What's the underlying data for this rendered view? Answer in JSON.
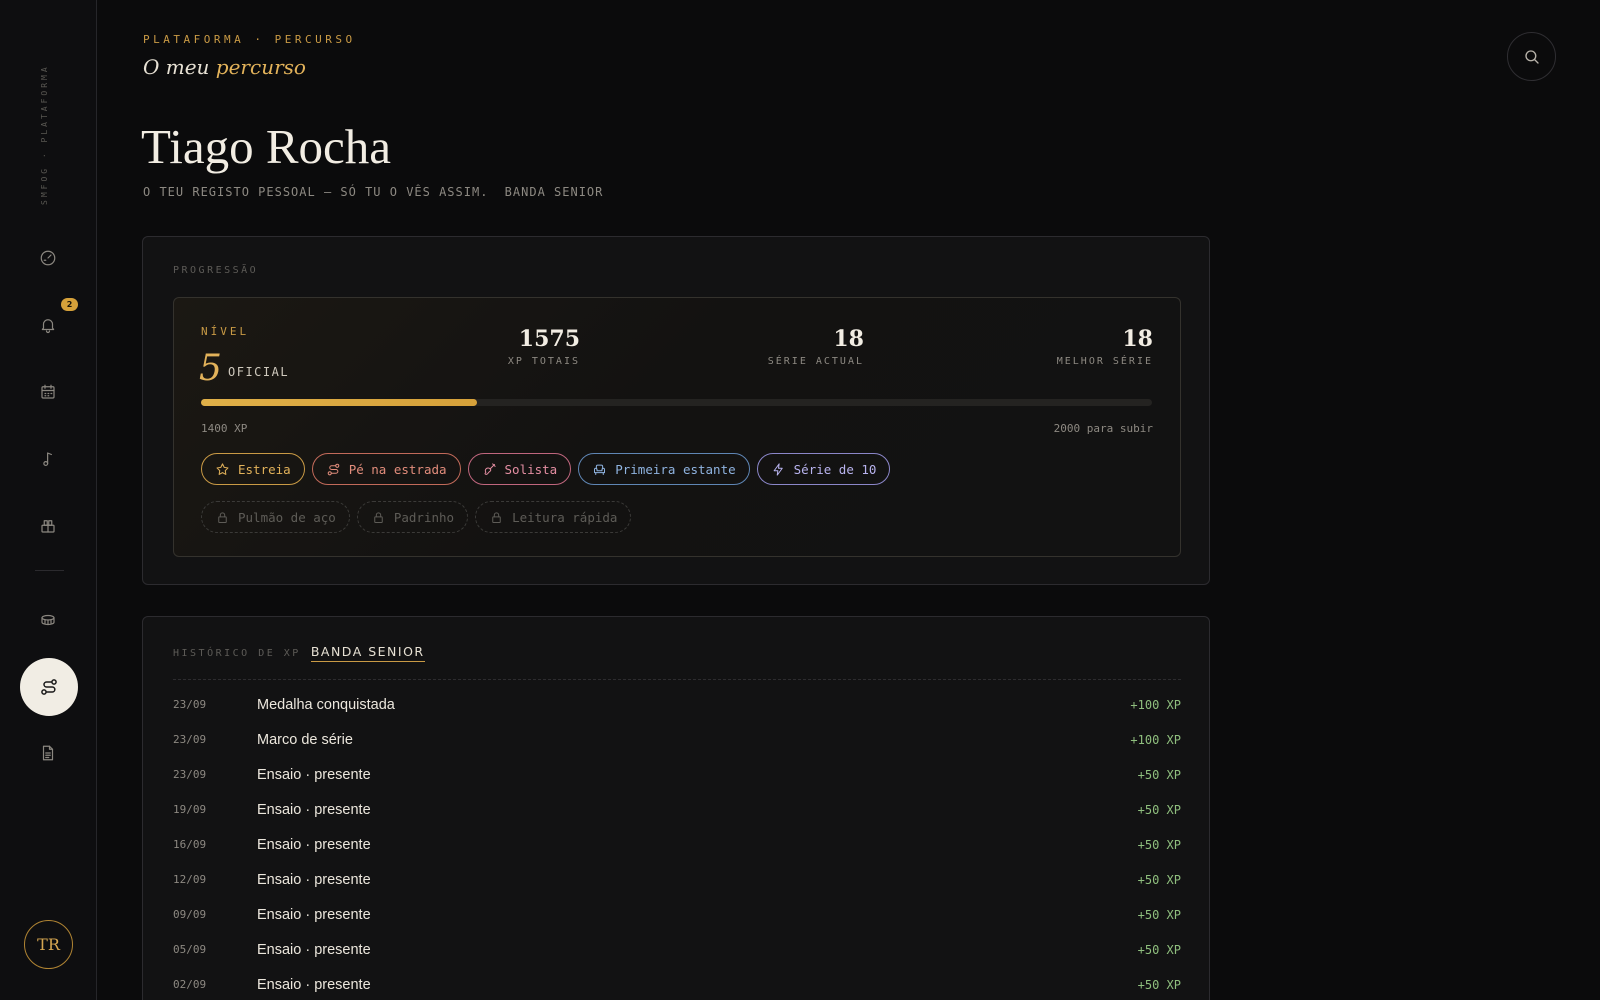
{
  "sidebar": {
    "brand": "SMFOG · PLATAFORMA",
    "notifications_count": "2",
    "items": [
      {
        "icon": "gauge-icon"
      },
      {
        "icon": "bell-icon"
      },
      {
        "icon": "calendar-icon"
      },
      {
        "icon": "music-note-icon"
      },
      {
        "icon": "blocks-icon"
      },
      {
        "icon": "drum-icon"
      },
      {
        "icon": "route-icon",
        "active": true
      },
      {
        "icon": "document-icon"
      }
    ],
    "avatar_initials": "TR"
  },
  "header": {
    "eyebrow": "PLATAFORMA · PERCURSO",
    "subtitle_pre": "O meu ",
    "subtitle_accent": "percurso"
  },
  "page": {
    "title": "Tiago Rocha",
    "subtitle": "O TEU REGISTO PESSOAL — SÓ TU O VÊS ASSIM.",
    "band": "BANDA SENIOR"
  },
  "progress": {
    "section_label": "PROGRESSÃO",
    "level_label": "NÍVEL",
    "level_number": "5",
    "level_name": "OFICIAL",
    "stats": [
      {
        "value": "1575",
        "label": "XP TOTAIS"
      },
      {
        "value": "18",
        "label": "SÉRIE ACTUAL"
      },
      {
        "value": "18",
        "label": "MELHOR SÉRIE"
      }
    ],
    "bar_fraction": 0.29,
    "bar_left": "1400 XP",
    "bar_right": "2000 para subir",
    "badges": [
      {
        "label": "Estreia",
        "icon": "star-icon"
      },
      {
        "label": "Pé na estrada",
        "icon": "route-icon"
      },
      {
        "label": "Solista",
        "icon": "guitar-icon"
      },
      {
        "label": "Primeira estante",
        "icon": "armchair-icon"
      },
      {
        "label": "Série de 10",
        "icon": "lightning-icon"
      }
    ],
    "locked_badges": [
      {
        "label": "Pulmão de aço",
        "icon": "lock-icon"
      },
      {
        "label": "Padrinho",
        "icon": "lock-icon"
      },
      {
        "label": "Leitura rápida",
        "icon": "lock-icon"
      }
    ]
  },
  "history": {
    "label": "HISTÓRICO DE XP",
    "tab": "BANDA SENIOR",
    "rows": [
      {
        "date": "23/09",
        "text": "Medalha conquistada",
        "xp": "+100 XP"
      },
      {
        "date": "23/09",
        "text": "Marco de série",
        "xp": "+100 XP"
      },
      {
        "date": "23/09",
        "text": "Ensaio · presente",
        "xp": "+50 XP"
      },
      {
        "date": "19/09",
        "text": "Ensaio · presente",
        "xp": "+50 XP"
      },
      {
        "date": "16/09",
        "text": "Ensaio · presente",
        "xp": "+50 XP"
      },
      {
        "date": "12/09",
        "text": "Ensaio · presente",
        "xp": "+50 XP"
      },
      {
        "date": "09/09",
        "text": "Ensaio · presente",
        "xp": "+50 XP"
      },
      {
        "date": "05/09",
        "text": "Ensaio · presente",
        "xp": "+50 XP"
      },
      {
        "date": "02/09",
        "text": "Ensaio · presente",
        "xp": "+50 XP"
      }
    ]
  },
  "colors": {
    "accent": "#e2b25a",
    "background": "#0b0b0c",
    "xp_positive": "#8fbf7e"
  }
}
